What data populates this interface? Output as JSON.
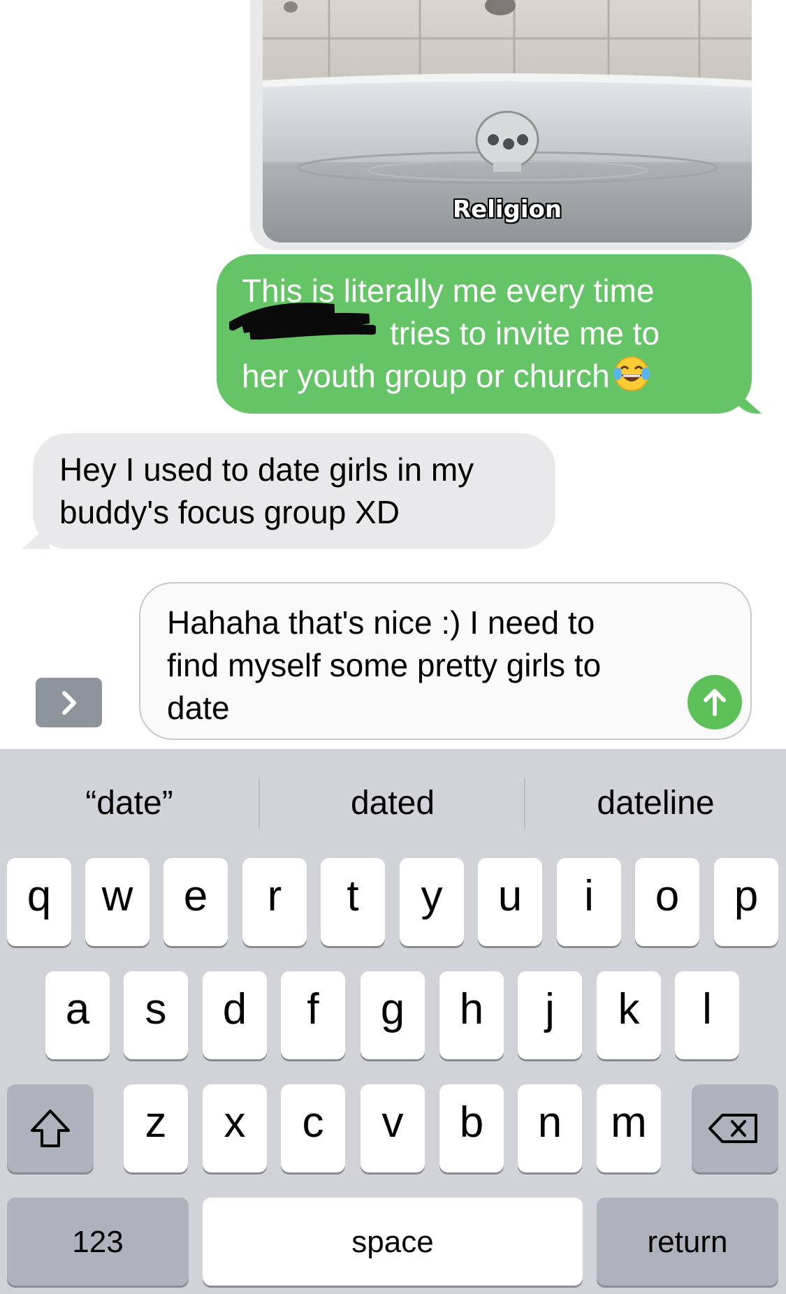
{
  "conversation": {
    "image_caption": "Religion",
    "sent_message": {
      "lines": [
        "This is literally me every time",
        "tries to invite me to",
        "her youth group or church"
      ],
      "emoji": "face-with-tears-of-joy"
    },
    "received_message": {
      "lines": [
        "Hey I used to date girls in my",
        "buddy's focus group XD"
      ]
    }
  },
  "compose": {
    "draft_lines": [
      "Hahaha that's nice :) I need to",
      "find myself some pretty girls to",
      "date"
    ],
    "apps_button_icon": "chevron-right-icon",
    "send_button_icon": "arrow-up-icon",
    "send_color": "#5cc159"
  },
  "keyboard": {
    "predictions": [
      "“date”",
      "dated",
      "dateline"
    ],
    "row1": [
      "q",
      "w",
      "e",
      "r",
      "t",
      "y",
      "u",
      "i",
      "o",
      "p"
    ],
    "row2": [
      "a",
      "s",
      "d",
      "f",
      "g",
      "h",
      "j",
      "k",
      "l"
    ],
    "row3": [
      "z",
      "x",
      "c",
      "v",
      "b",
      "n",
      "m"
    ],
    "shift_icon": "shift-icon",
    "delete_icon": "delete-icon",
    "numbers_label": "123",
    "space_label": "space",
    "return_label": "return"
  },
  "colors": {
    "sent_bubble": "#65c466",
    "received_bubble": "#e9e9eb",
    "keyboard_bg": "#d1d3d9"
  }
}
